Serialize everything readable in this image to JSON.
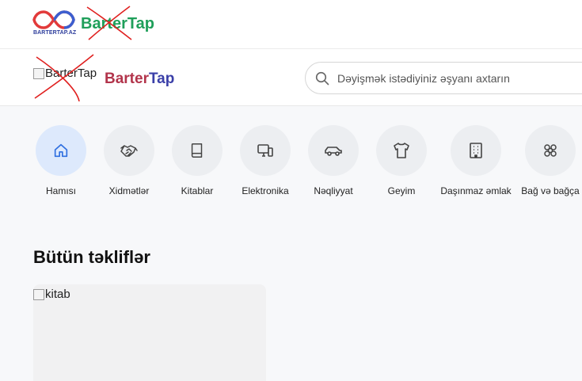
{
  "topbar": {
    "logo_small_text": "BARTERTAP.AZ",
    "logo_word_part1": "Barter",
    "logo_word_part2": "Tap"
  },
  "header": {
    "logo_alt": "BarterTap",
    "brand_part1": "Barter",
    "brand_part2": "Tap",
    "search_placeholder": "Dəyişmək istədiyiniz əşyanı axtarın"
  },
  "categories": [
    {
      "label": "Hamısı",
      "icon": "home-icon",
      "active": true
    },
    {
      "label": "Xidmətlər",
      "icon": "handshake-icon"
    },
    {
      "label": "Kitablar",
      "icon": "book-icon"
    },
    {
      "label": "Elektronika",
      "icon": "devices-icon"
    },
    {
      "label": "Nəqliyyat",
      "icon": "car-icon"
    },
    {
      "label": "Geyim",
      "icon": "shirt-icon"
    },
    {
      "label": "Daşınmaz əmlak",
      "icon": "building-icon"
    },
    {
      "label": "Bağ və bağça",
      "icon": "flower-icon"
    }
  ],
  "section": {
    "title": "Bütün təkliflər"
  },
  "listing": {
    "image_alt": "kitab"
  },
  "colors": {
    "accent_blue": "#2f6fe0",
    "active_bg": "#dde9fc",
    "cross_red": "#e0201f"
  }
}
